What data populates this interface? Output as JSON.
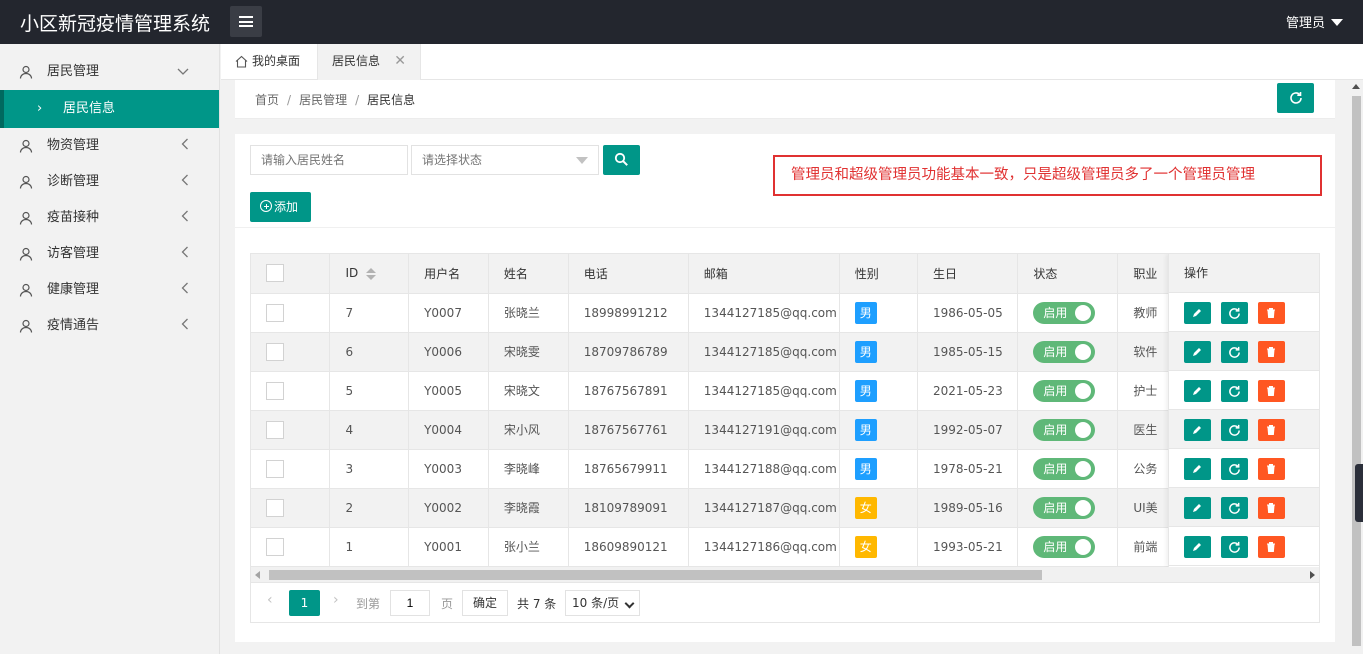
{
  "app": {
    "title": "小区新冠疫情管理系统",
    "user_label": "管理员"
  },
  "sidebar": {
    "items": [
      {
        "label": "居民管理",
        "arrow": "chevron-down"
      },
      {
        "label": "居民信息",
        "sub": true
      },
      {
        "label": "物资管理",
        "arrow": "chevron-left"
      },
      {
        "label": "诊断管理",
        "arrow": "chevron-left"
      },
      {
        "label": "疫苗接种",
        "arrow": "chevron-left"
      },
      {
        "label": "访客管理",
        "arrow": "chevron-left"
      },
      {
        "label": "健康管理",
        "arrow": "chevron-left"
      },
      {
        "label": "疫情通告",
        "arrow": "chevron-left"
      }
    ]
  },
  "tabs": {
    "home": "我的桌面",
    "active": "居民信息"
  },
  "breadcrumb": {
    "home": "首页",
    "section": "居民管理",
    "current": "居民信息",
    "sep": "/"
  },
  "search": {
    "name_placeholder": "请输入居民姓名",
    "status_placeholder": "请选择状态"
  },
  "toolbar": {
    "add_label": "添加"
  },
  "notice": "管理员和超级管理员功能基本一致，只是超级管理员多了一个管理员管理",
  "table": {
    "headers": [
      "ID",
      "用户名",
      "姓名",
      "电话",
      "邮箱",
      "性别",
      "生日",
      "状态",
      "职业",
      "操作"
    ],
    "rows": [
      {
        "id": "7",
        "username": "Y0007",
        "name": "张晓兰",
        "phone": "18998991212",
        "email": "1344127185@qq.com",
        "gender": "男",
        "birthday": "1986-05-05",
        "status": "启用",
        "job": "教师"
      },
      {
        "id": "6",
        "username": "Y0006",
        "name": "宋晓雯",
        "phone": "18709786789",
        "email": "1344127185@qq.com",
        "gender": "男",
        "birthday": "1985-05-15",
        "status": "启用",
        "job": "软件"
      },
      {
        "id": "5",
        "username": "Y0005",
        "name": "宋晓文",
        "phone": "18767567891",
        "email": "1344127185@qq.com",
        "gender": "男",
        "birthday": "2021-05-23",
        "status": "启用",
        "job": "护士"
      },
      {
        "id": "4",
        "username": "Y0004",
        "name": "宋小风",
        "phone": "18767567761",
        "email": "1344127191@qq.com",
        "gender": "男",
        "birthday": "1992-05-07",
        "status": "启用",
        "job": "医生"
      },
      {
        "id": "3",
        "username": "Y0003",
        "name": "李晓峰",
        "phone": "18765679911",
        "email": "1344127188@qq.com",
        "gender": "男",
        "birthday": "1978-05-21",
        "status": "启用",
        "job": "公务"
      },
      {
        "id": "2",
        "username": "Y0002",
        "name": "李晓霞",
        "phone": "18109789091",
        "email": "1344127187@qq.com",
        "gender": "女",
        "birthday": "1989-05-16",
        "status": "启用",
        "job": "UI美"
      },
      {
        "id": "1",
        "username": "Y0001",
        "name": "张小兰",
        "phone": "18609890121",
        "email": "1344127186@qq.com",
        "gender": "女",
        "birthday": "1993-05-21",
        "status": "启用",
        "job": "前端"
      }
    ]
  },
  "pagination": {
    "current": "1",
    "goto_label": "到第",
    "page_value": "1",
    "page_word": "页",
    "confirm": "确定",
    "total": "共 7 条",
    "page_size": "10 条/页"
  },
  "colors": {
    "accent": "#009688",
    "danger": "#ff5722",
    "male": "#1e9fff",
    "female": "#ffb800",
    "switch_on": "#5fb878",
    "header_bg": "#23262e",
    "notice_border": "#e03131"
  }
}
